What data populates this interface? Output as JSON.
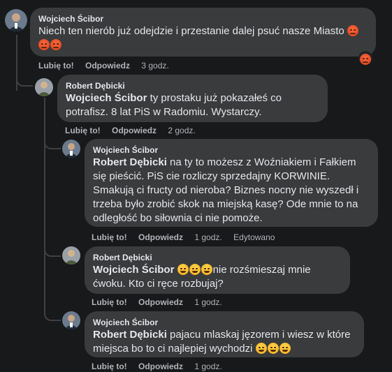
{
  "comments": [
    {
      "author": "Wojciech Ścibor",
      "text": "Niech ten nierób już odejdzie i przestanie dalej psuć nasze Miasto",
      "emojis": [
        "angry-emoji",
        "angry-emoji",
        "angry-emoji"
      ],
      "actions": {
        "like": "Lubię to!",
        "reply": "Odpowiedz",
        "time": "3 godz."
      },
      "reaction": "angry-emoji"
    },
    {
      "author": "Robert Dębicki",
      "mention": "Wojciech Ścibor",
      "text": " ty prostaku już pokazałeś co potrafisz. 8 lat PiS w Radomiu. Wystarczy.",
      "actions": {
        "like": "Lubię to!",
        "reply": "Odpowiedz",
        "time": "2 godz."
      }
    },
    {
      "author": "Wojciech Ścibor",
      "mention": "Robert Dębicki",
      "text": " na ty to możesz z Woźniakiem i Fałkiem się pieścić. PiS cie rozliczy sprzedajny KORWINIE. Smakują ci fructy od nieroba? Biznes nocny nie wyszedł i trzeba było zrobić skok na miejską kasę? Ode mnie to na odległość bo siłownia ci nie pomoże.",
      "actions": {
        "like": "Lubię to!",
        "reply": "Odpowiedz",
        "time": "1 godz.",
        "edited": "Edytowano"
      }
    },
    {
      "author": "Robert Dębicki",
      "mention": "Wojciech Ścibor",
      "text": "nie rozśmieszaj mnie ćwoku. Kto ci ręce rozbujaj?",
      "emojis": [
        "rofl-emoji",
        "rofl-emoji",
        "rofl-emoji"
      ],
      "actions": {
        "like": "Lubię to!",
        "reply": "Odpowiedz",
        "time": "1 godz."
      }
    },
    {
      "author": "Wojciech Ścibor",
      "mention": "Robert Dębicki",
      "text": " pajacu mlaskaj jęzorem i wiesz w które miejsca bo to ci najlepiej wychodzi",
      "emojis": [
        "joy-emoji",
        "joy-emoji",
        "joy-emoji"
      ],
      "actions": {
        "like": "Lubię to!",
        "reply": "Odpowiedz",
        "time": "1 godz."
      }
    }
  ],
  "colors": {
    "background": "#18191a",
    "bubble": "#3a3b3c",
    "text": "#e4e6eb",
    "secondary": "#b0b3b8",
    "thread": "#3e4042"
  }
}
